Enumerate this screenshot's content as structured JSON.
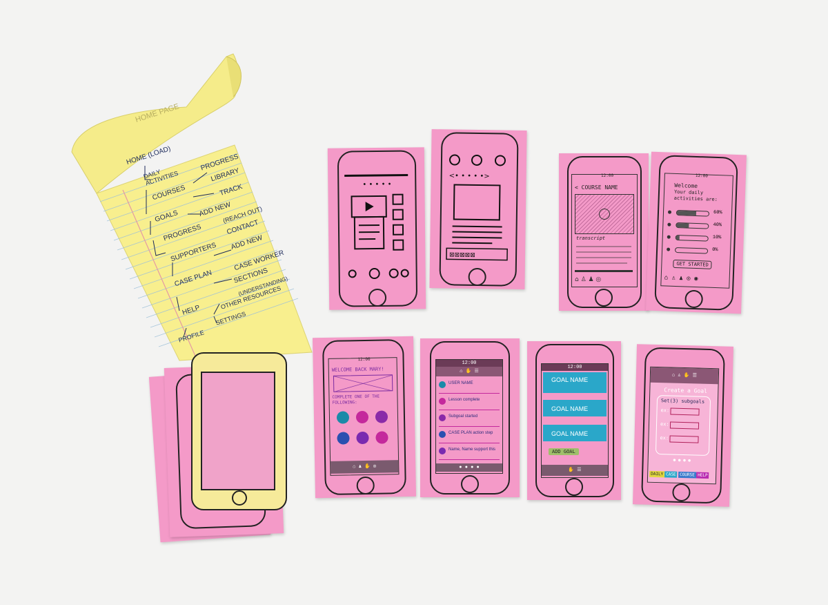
{
  "colors": {
    "background": "#f3f3f2",
    "notepad": "#f8ef8e",
    "card_pink": "#f49ac8",
    "ink": "#1c2a5a",
    "goal_blue": "#2aa7c9",
    "dark_bar": "#6b3b57"
  },
  "notepad": {
    "header_sketch": "HOME PAGE",
    "sitemap": {
      "home": "HOME (LOAD)",
      "daily_activities": "DAILY ACTIVITIES",
      "progress": "PROGRESS",
      "library": "LIBRARY",
      "courses": "COURSES",
      "track": "TRACK",
      "goals": "GOALS",
      "add_new_1": "ADD NEW",
      "progress_2": "PROGRESS",
      "reach_out": "(REACH OUT)",
      "contact": "CONTACT",
      "supporters": "SUPPORTERS",
      "add_new_2": "ADD NEW",
      "case_worker": "CASE WORKER",
      "case_plan": "CASE PLAN",
      "sections": "SECTIONS",
      "understanding": "(UNDERSTANDING)",
      "help": "HELP",
      "other_resources": "OTHER RESOURCES",
      "settings": "SETTINGS",
      "profile": "PROFILE"
    }
  },
  "cards": {
    "course": {
      "status_time": "12:00",
      "title": "< COURSE NAME",
      "transcript": "transcript"
    },
    "daily": {
      "status_time": "12:00",
      "welcome": "Welcome",
      "subtitle": "Your daily activities are:",
      "pcts": [
        "60%",
        "40%",
        "10%",
        "0%"
      ],
      "progress": [
        0.6,
        0.4,
        0.1,
        0.0
      ],
      "button": "GET STARTED"
    },
    "welcome_back": {
      "status_time": "12:00",
      "greeting": "WELCOME BACK MARY!",
      "instruction": "COMPLETE ONE OF THE FOLLOWING:"
    },
    "feed": {
      "status_time": "12:00",
      "items": [
        "USER NAME",
        "Lesson complete",
        "Subgoal started",
        "CASE PLAN action step",
        "Name, Name support this"
      ]
    },
    "goals": {
      "status_time": "12:00",
      "goal_label": "GOAL NAME",
      "button": "ADD GOAL"
    },
    "create_goal": {
      "title": "Create a Goal",
      "subgoals": "Set(3) subgoals",
      "ex": [
        "ex:",
        "ex:",
        "ex:"
      ],
      "tabs": [
        "DAILY",
        "CASE",
        "COURSE",
        "HELP"
      ]
    }
  }
}
